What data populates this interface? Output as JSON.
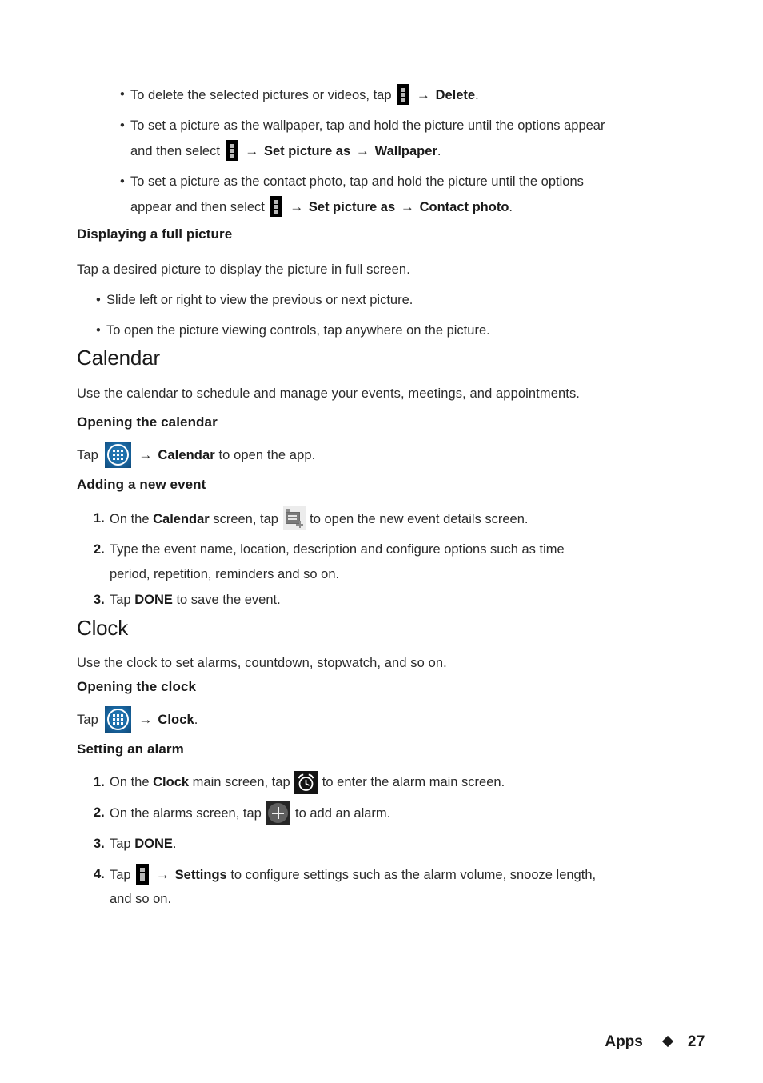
{
  "page": {
    "number": "27",
    "footer_label": "Apps",
    "footer_separator": "diamond"
  },
  "gallery_bullets": [
    {
      "pre": "To delete the selected pictures or videos, tap ",
      "icon": "overflow-menu-icon",
      "mid": " → ",
      "bold1": "Delete",
      "post": "."
    },
    {
      "line1": "To set a picture as the wallpaper, tap and hold the picture until the options appear",
      "line2_pre": "and then select ",
      "icon": "overflow-menu-icon",
      "line2_arrow1": " → ",
      "bold1": "Set picture as",
      "line2_arrow2": " → ",
      "bold2": "Wallpaper",
      "post": "."
    },
    {
      "line1": "To set a picture as the contact photo, tap and hold the picture until the options",
      "line2_pre": "appear and then select ",
      "icon": "overflow-menu-icon",
      "line2_arrow1": " → ",
      "bold1": "Set picture as",
      "line2_arrow2": " → ",
      "bold2": "Contact photo",
      "post": "."
    }
  ],
  "displaying_full_picture": {
    "heading": "Displaying a full picture",
    "intro": "Tap a desired picture to display the picture in full screen.",
    "bullets": [
      "Slide left or right to view the previous  or next picture.",
      "To open the picture viewing controls, tap anywhere on the picture."
    ]
  },
  "calendar": {
    "heading": "Calendar",
    "intro": "Use the calendar to schedule and manage your events, meetings, and appointments.",
    "opening": {
      "heading": "Opening the calendar",
      "tap_label": "Tap ",
      "icon": "app-drawer-icon",
      "arrow": " → ",
      "bold": "Calendar",
      "post": " to open the app."
    },
    "adding_event": {
      "heading": "Adding a new event",
      "steps": [
        {
          "num": "1.",
          "pre": "On the ",
          "bold1": "Calendar",
          "mid": " screen, tap ",
          "icon": "new-event-icon",
          "post": " to open the new event details screen."
        },
        {
          "num": "2.",
          "line1": "Type the event name, location, description and configure options such as time",
          "line2": "period, repetition, reminders and so on."
        },
        {
          "num": "3.",
          "pre": "Tap ",
          "bold1": "DONE",
          "post": " to save the event."
        }
      ]
    }
  },
  "clock": {
    "heading": "Clock",
    "intro": "Use the clock to set alarms, countdown, stopwatch, and so on.",
    "opening": {
      "heading": "Opening the clock",
      "tap_label": "Tap ",
      "icon": "app-drawer-icon",
      "arrow": " → ",
      "bold": "Clock",
      "post": "."
    },
    "setting_alarm": {
      "heading": "Setting an alarm",
      "steps": [
        {
          "num": "1.",
          "pre": "On the ",
          "bold1": "Clock",
          "mid": " main screen, tap ",
          "icon": "alarm-clock-icon",
          "post": " to enter the alarm main screen."
        },
        {
          "num": "2.",
          "pre": "On the alarms screen, tap ",
          "icon": "add-plus-icon",
          "post": " to add an alarm."
        },
        {
          "num": "3.",
          "pre": "Tap ",
          "bold1": "DONE",
          "post": "."
        },
        {
          "num": "4.",
          "pre": "Tap ",
          "icon": "overflow-menu-icon",
          "mid": " →  ",
          "bold1": "Settings",
          "post": " to configure settings such as the alarm volume, snooze length,",
          "line2": "and so on."
        }
      ]
    }
  },
  "colors": {
    "text": "#2b2b2b",
    "heading": "#1a1a1a",
    "app_drawer_blue": "#1a6ca8",
    "icon_black": "#000000",
    "page_background": "#ffffff"
  }
}
